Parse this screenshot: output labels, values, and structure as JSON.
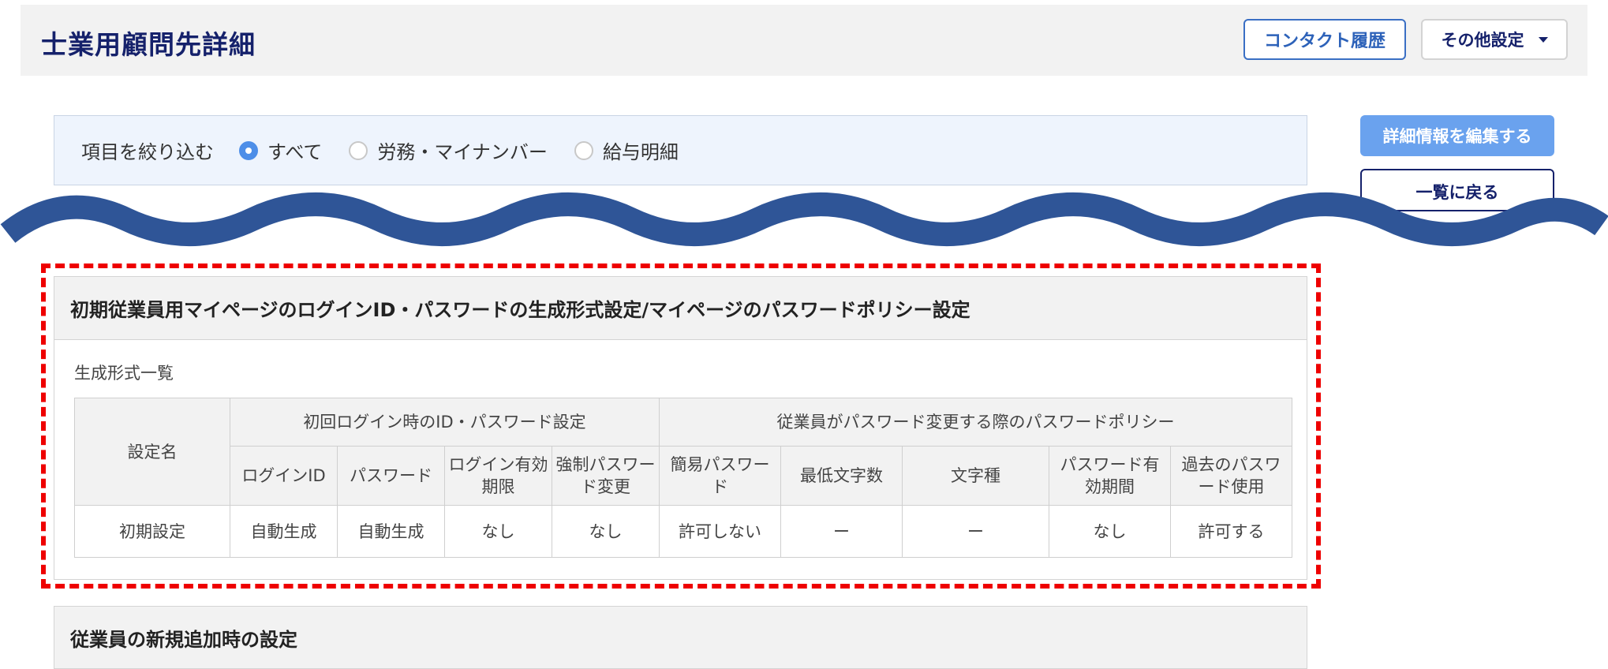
{
  "header": {
    "title": "士業用顧問先詳細",
    "contact_history_label": "コンタクト履歴",
    "other_settings_label": "その他設定"
  },
  "filter": {
    "label": "項目を絞り込む",
    "options": [
      "すべて",
      "労務・マイナンバー",
      "給与明細"
    ],
    "selected": "すべて"
  },
  "actions": {
    "edit_label": "詳細情報を編集する",
    "back_label": "一覧に戻る"
  },
  "section": {
    "title": "初期従業員用マイページのログインID・パスワードの生成形式設定/マイページのパスワードポリシー設定",
    "subtitle": "生成形式一覧",
    "table": {
      "col_setting_name": "設定名",
      "group_initial": "初回ログイン時のID・パスワード設定",
      "group_policy": "従業員がパスワード変更する際のパスワードポリシー",
      "headers": [
        "ログインID",
        "パスワード",
        "ログイン有効期限",
        "強制パスワード変更",
        "簡易パスワード",
        "最低文字数",
        "文字種",
        "パスワード有効期間",
        "過去のパスワード使用"
      ],
      "row": {
        "name": "初期設定",
        "cells": [
          "自動生成",
          "自動生成",
          "なし",
          "なし",
          "許可しない",
          "ー",
          "ー",
          "なし",
          "許可する"
        ]
      }
    }
  },
  "section2": {
    "title": "従業員の新規追加時の設定"
  },
  "colors": {
    "title_navy": "#15216b",
    "accent_blue": "#4d8ee8",
    "wave_blue": "#2f5597",
    "highlight_red": "#ee0000"
  }
}
